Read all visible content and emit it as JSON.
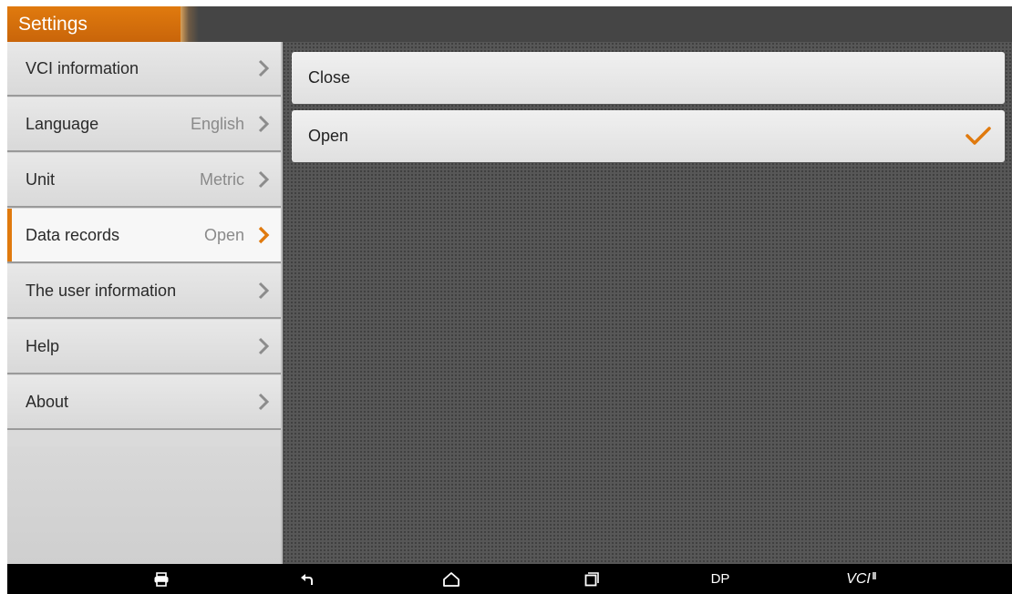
{
  "app": {
    "title": "Settings"
  },
  "sidebar": {
    "items": [
      {
        "label": "VCI information",
        "value": ""
      },
      {
        "label": "Language",
        "value": "English"
      },
      {
        "label": "Unit",
        "value": "Metric"
      },
      {
        "label": "Data records",
        "value": "Open",
        "active": true
      },
      {
        "label": "The user information",
        "value": ""
      },
      {
        "label": "Help",
        "value": ""
      },
      {
        "label": "About",
        "value": ""
      }
    ]
  },
  "options": [
    {
      "label": "Close",
      "selected": false
    },
    {
      "label": "Open",
      "selected": true
    }
  ],
  "navbar": {
    "dp_label": "DP",
    "vci_label": "VCI"
  },
  "colors": {
    "accent": "#e07a0e",
    "titlebar": "#454545",
    "navbar": "#000000"
  }
}
